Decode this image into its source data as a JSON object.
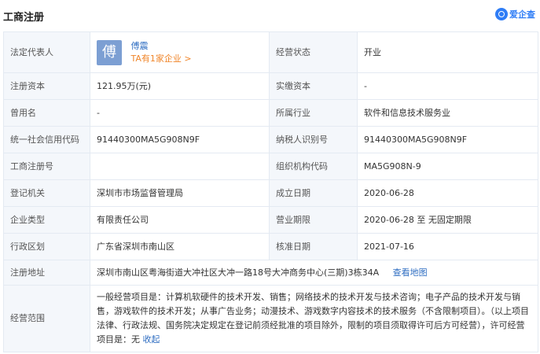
{
  "header": {
    "title": "工商注册",
    "brand": "爱企查"
  },
  "legal_rep": {
    "label": "法定代表人",
    "avatar_char": "傅",
    "name": "傅震",
    "count": "TA有1家企业 >"
  },
  "rows": [
    {
      "l1": "注册资本",
      "v1": "121.95万(元)",
      "l2": "实缴资本",
      "v2": "-"
    },
    {
      "l1": "曾用名",
      "v1": "-",
      "l2": "所属行业",
      "v2": "软件和信息技术服务业"
    },
    {
      "l1": "统一社会信用代码",
      "v1": "91440300MA5G908N9F",
      "l2": "纳税人识别号",
      "v2": "91440300MA5G908N9F"
    },
    {
      "l1": "工商注册号",
      "v1": "",
      "l2": "组织机构代码",
      "v2": "MA5G908N-9"
    },
    {
      "l1": "登记机关",
      "v1": "深圳市市场监督管理局",
      "l2": "成立日期",
      "v2": "2020-06-28"
    },
    {
      "l1": "企业类型",
      "v1": "有限责任公司",
      "l2": "营业期限",
      "v2": "2020-06-28 至 无固定期限"
    },
    {
      "l1": "行政区划",
      "v1": "广东省深圳市南山区",
      "l2": "核准日期",
      "v2": "2021-07-16"
    }
  ],
  "status": {
    "label": "经营状态",
    "value": "开业"
  },
  "address": {
    "label": "注册地址",
    "value": "深圳市南山区粤海街道大冲社区大冲一路18号大冲商务中心(三期)3栋34A",
    "map_link": "查看地图"
  },
  "scope": {
    "label": "经营范围",
    "text": "一般经营项目是：计算机软硬件的技术开发、销售；网络技术的技术开发与技术咨询；电子产品的技术开发与销售，游戏软件的技术开发；从事广告业务；动漫技术、游戏数字内容技术的技术服务（不含限制项目）。（以上项目法律、行政法规、国务院决定规定在登记前须经批准的项目除外，限制的项目须取得许可后方可经营），许可经营项目是：无",
    "collapse": "收起"
  }
}
